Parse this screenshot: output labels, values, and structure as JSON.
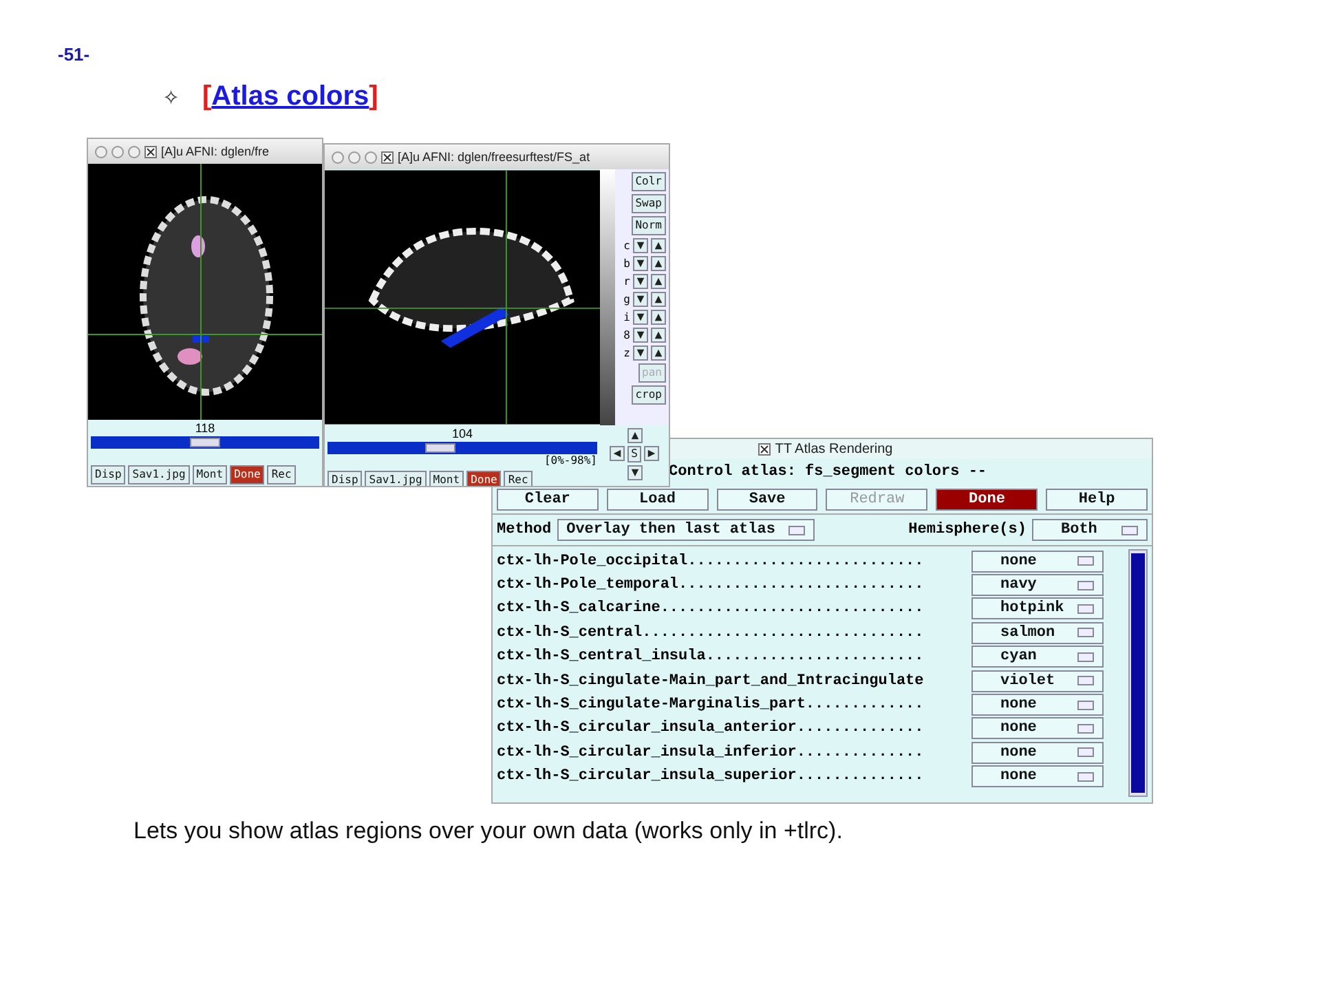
{
  "page_number": "-51-",
  "heading": {
    "bullet": "✧",
    "open_bracket": "[",
    "link": "Atlas colors",
    "close_bracket": "]"
  },
  "viewer_windows": [
    {
      "title": "[A]u AFNI: dglen/fre",
      "slice_number": "118",
      "level": 0.5,
      "buttons": [
        {
          "label": "Disp",
          "kind": "normal"
        },
        {
          "label": "Sav1.jpg",
          "kind": "normal"
        },
        {
          "label": "Mont",
          "kind": "normal"
        },
        {
          "label": "Done",
          "kind": "danger"
        },
        {
          "label": "Rec",
          "kind": "normal"
        }
      ]
    },
    {
      "title": "[A]u AFNI: dglen/freesurftest/FS_at",
      "slice_number": "104",
      "level": 0.42,
      "status": "[0%-98%]",
      "nav_button": "S",
      "side_buttons": [
        {
          "label": "Colr",
          "disabled": false
        },
        {
          "label": "Swap",
          "disabled": false
        },
        {
          "label": "Norm",
          "disabled": false
        }
      ],
      "arrow_labels": [
        "c",
        "b",
        "r",
        "g",
        "i",
        "8",
        "z"
      ],
      "lower_buttons": [
        {
          "label": "pan",
          "disabled": true
        },
        {
          "label": "crop",
          "disabled": false
        }
      ],
      "buttons": [
        {
          "label": "Disp",
          "kind": "normal"
        },
        {
          "label": "Sav1.jpg",
          "kind": "normal"
        },
        {
          "label": "Mont",
          "kind": "normal"
        },
        {
          "label": "Done",
          "kind": "danger"
        },
        {
          "label": "Rec",
          "kind": "normal"
        }
      ]
    }
  ],
  "atlas_window": {
    "title": "TT Atlas Rendering",
    "header": "Control atlas: fs_segment colors --",
    "buttons": [
      {
        "label": "Clear",
        "kind": "normal"
      },
      {
        "label": "Load",
        "kind": "normal"
      },
      {
        "label": "Save",
        "kind": "normal"
      },
      {
        "label": "Redraw",
        "kind": "disabled"
      },
      {
        "label": "Done",
        "kind": "danger"
      },
      {
        "label": "Help",
        "kind": "normal"
      }
    ],
    "method": {
      "label": "Method",
      "value": "Overlay then last atlas"
    },
    "hemisphere": {
      "label": "Hemisphere(s)",
      "value": "Both"
    },
    "regions": [
      {
        "name": "ctx-lh-Pole_occipital..........................",
        "assigned_color": "none"
      },
      {
        "name": "ctx-lh-Pole_temporal...........................",
        "assigned_color": "navy"
      },
      {
        "name": "ctx-lh-S_calcarine.............................",
        "assigned_color": "hotpink"
      },
      {
        "name": "ctx-lh-S_central...............................",
        "assigned_color": "salmon"
      },
      {
        "name": "ctx-lh-S_central_insula........................",
        "assigned_color": "cyan"
      },
      {
        "name": "ctx-lh-S_cingulate-Main_part_and_Intracingulate",
        "assigned_color": "violet"
      },
      {
        "name": "ctx-lh-S_cingulate-Marginalis_part.............",
        "assigned_color": "none"
      },
      {
        "name": "ctx-lh-S_circular_insula_anterior..............",
        "assigned_color": "none"
      },
      {
        "name": "ctx-lh-S_circular_insula_inferior..............",
        "assigned_color": "none"
      },
      {
        "name": "ctx-lh-S_circular_insula_superior..............",
        "assigned_color": "none"
      }
    ]
  },
  "caption": "Lets you show atlas regions over your own data (works only in +tlrc)."
}
